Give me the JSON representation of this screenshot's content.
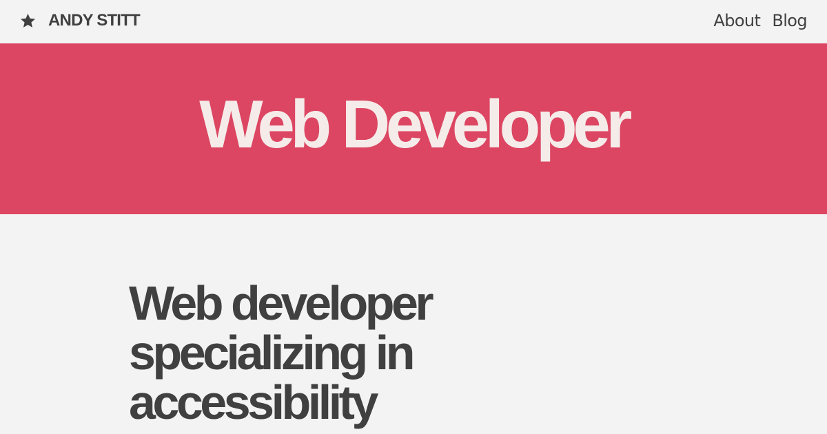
{
  "header": {
    "brand_name": "ANDY STITT",
    "brand_icon": "star-icon",
    "nav": [
      {
        "label": "About"
      },
      {
        "label": "Blog"
      }
    ]
  },
  "banner": {
    "title": "Web Developer",
    "background_color": "#dc4662",
    "text_color": "#f5ecea"
  },
  "main": {
    "headline": "Web developer specializing in accessibility"
  },
  "colors": {
    "page_background": "#f3f3f3",
    "text": "#404040"
  }
}
